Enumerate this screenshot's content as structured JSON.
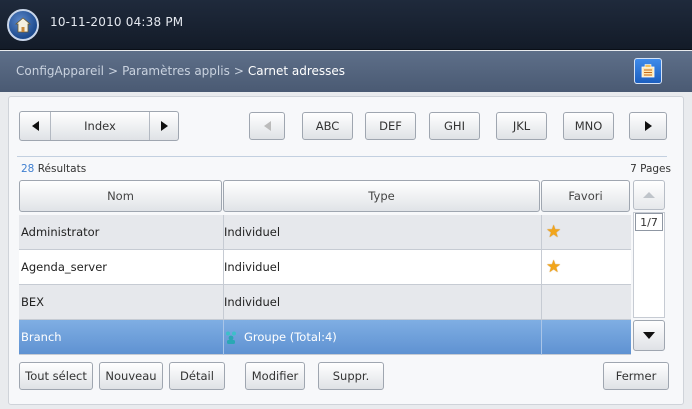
{
  "header": {
    "datetime": "10-11-2010 04:38 PM"
  },
  "breadcrumb": {
    "items": [
      "ConfigAppareil",
      "Paramètres applis",
      "Carnet adresses"
    ],
    "separator": ">"
  },
  "index_nav": {
    "label": "Index"
  },
  "letter_tabs": [
    "ABC",
    "DEF",
    "GHI",
    "JKL",
    "MNO"
  ],
  "results": {
    "count": "28",
    "suffix": " Résultats",
    "pages": "7 Pages"
  },
  "table": {
    "headers": {
      "name": "Nom",
      "type": "Type",
      "favorite": "Favori"
    },
    "rows": [
      {
        "name": "Administrator",
        "type": "Individuel",
        "favorite": true
      },
      {
        "name": "Agenda_server",
        "type": "Individuel",
        "favorite": true
      },
      {
        "name": "BEX",
        "type": "Individuel",
        "favorite": false
      },
      {
        "name": "Branch",
        "type": "Groupe (Total:4)",
        "favorite": false,
        "selected": true
      }
    ]
  },
  "scroll": {
    "page_indicator": "1/7"
  },
  "actions": {
    "select_all": "Tout sélect",
    "new": "Nouveau",
    "detail": "Détail",
    "edit": "Modifier",
    "delete": "Suppr.",
    "close": "Fermer"
  },
  "colors": {
    "accent": "#3f7fd0",
    "selected_row": "#6a9cd8",
    "star": "#f2a51a"
  }
}
